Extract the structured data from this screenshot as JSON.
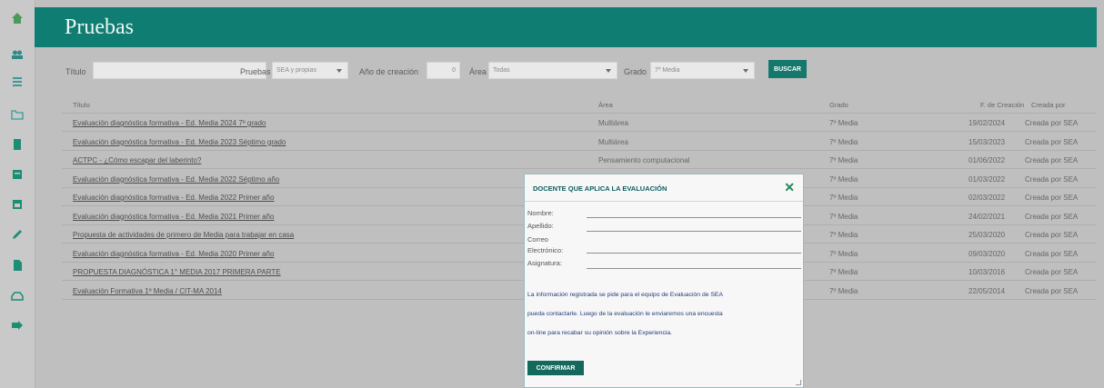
{
  "page": {
    "title": "Pruebas"
  },
  "sidebar": {
    "icons": [
      "home-icon",
      "users-icon",
      "list-icon",
      "folder-icon",
      "book-icon",
      "archive-icon",
      "calendar-icon",
      "pencil-icon",
      "file-icon",
      "inbox-icon",
      "export-icon"
    ]
  },
  "filters": {
    "titulo_label": "Título",
    "pruebas_label": "Pruebas",
    "pruebas_value": "SEA y propias",
    "anio_label": "Año de creación",
    "anio_value": "0",
    "area_label": "Área",
    "area_value": "Todas",
    "grado_label": "Grado",
    "grado_value": "7º Media",
    "buscar_label": "BUSCAR"
  },
  "table": {
    "headers": {
      "titulo": "Título",
      "area": "Área",
      "grado": "Grado",
      "fecha": "F. de Creación",
      "creada": "Creada por"
    },
    "rows": [
      {
        "titulo": "Evaluación diagnóstica formativa - Ed. Media 2024 7º grado",
        "area": "Multiárea",
        "grado": "7º Media",
        "fecha": "19/02/2024",
        "creada": "Creada por SEA"
      },
      {
        "titulo": "Evaluación diagnóstica formativa - Ed. Media 2023 Séptimo grado",
        "area": "Multiárea",
        "grado": "7º Media",
        "fecha": "15/03/2023",
        "creada": "Creada por SEA"
      },
      {
        "titulo": "ACTPC - ¿Cómo escapar del laberinto?",
        "area": "Pensamiento computacional",
        "grado": "7º Media",
        "fecha": "01/06/2022",
        "creada": "Creada por SEA"
      },
      {
        "titulo": "Evaluación diagnóstica formativa - Ed. Media 2022 Séptimo año",
        "area": "",
        "grado": "7º Media",
        "fecha": "01/03/2022",
        "creada": "Creada por SEA"
      },
      {
        "titulo": "Evaluación diagnóstica formativa - Ed. Media 2022 Primer año",
        "area": "",
        "grado": "7º Media",
        "fecha": "02/03/2022",
        "creada": "Creada por SEA"
      },
      {
        "titulo": "Evaluación diagnóstica formativa - Ed. Media 2021 Primer año",
        "area": "",
        "grado": "7º Media",
        "fecha": "24/02/2021",
        "creada": "Creada por SEA"
      },
      {
        "titulo": "Propuesta de actividades de primero de Media para trabajar en casa",
        "area": "",
        "grado": "7º Media",
        "fecha": "25/03/2020",
        "creada": "Creada por SEA"
      },
      {
        "titulo": "Evaluación diagnóstica formativa - Ed. Media 2020 Primer año",
        "area": "",
        "grado": "7º Media",
        "fecha": "09/03/2020",
        "creada": "Creada por SEA"
      },
      {
        "titulo": "PROPUESTA DIAGNÓSTICA 1° MEDIA 2017 PRIMERA PARTE",
        "area": "",
        "grado": "7º Media",
        "fecha": "10/03/2016",
        "creada": "Creada por SEA"
      },
      {
        "titulo": "Evaluación Formativa 1º Media / CIT-MA 2014",
        "area": "",
        "grado": "7º Media",
        "fecha": "22/05/2014",
        "creada": "Creada por SEA"
      }
    ]
  },
  "modal": {
    "title": "DOCENTE QUE APLICA LA EVALUACIÓN",
    "close": "✕",
    "fields": [
      {
        "label": "Nombre:"
      },
      {
        "label": "Apellido:"
      },
      {
        "label": "Correo"
      },
      {
        "label": "Electrónico:"
      },
      {
        "label": "Asignatura:"
      }
    ],
    "info_lines": [
      "La información registrada se pide para el equipo de Evaluación de SEA",
      "pueda contactarle. Luego de la evaluación le enviaremos una encuesta",
      "on-line para recabar su opinión sobre la Experiencia."
    ],
    "confirm_label": "CONFIRMAR"
  }
}
